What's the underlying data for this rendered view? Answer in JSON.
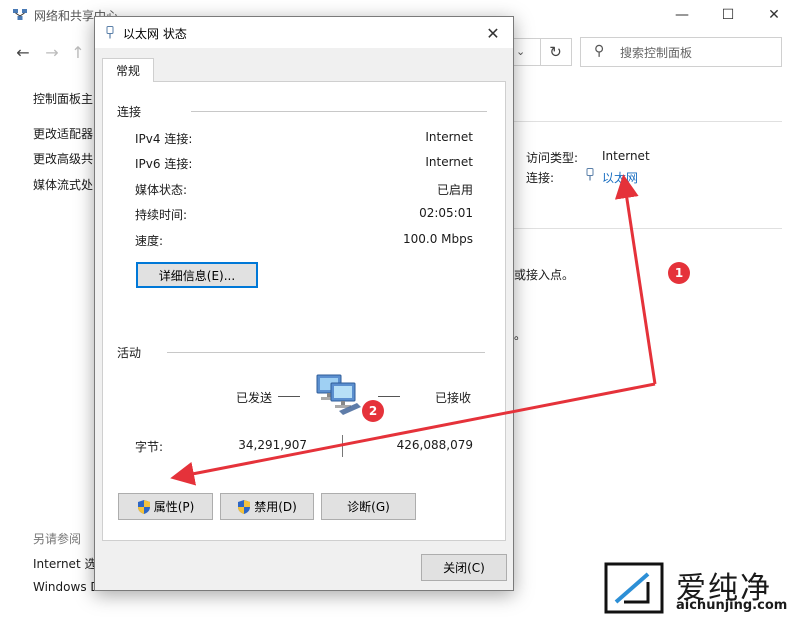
{
  "background_window": {
    "title": "网络和共享中心",
    "controls": {
      "minimize": "—",
      "maximize": "☐",
      "close": "✕"
    },
    "nav": {
      "back": "←",
      "forward": "→",
      "up": "↑",
      "refresh": "↻"
    },
    "search_placeholder": "搜索控制面板",
    "sidebar": {
      "home": "控制面板主",
      "links": [
        "更改适配器",
        "更改高级共",
        "媒体流式处"
      ],
      "see_also_label": "另请参阅",
      "see_also": [
        "Internet 选",
        "Windows D"
      ]
    },
    "access_type_label": "访问类型:",
    "access_type_value": "Internet",
    "connection_label": "连接:",
    "connection_value": "以太网",
    "fragment1": "或接入点。",
    "fragment2": "。"
  },
  "dialog": {
    "title": "以太网 状态",
    "close_glyph": "✕",
    "tab": "常规",
    "connection_group": "连接",
    "rows": [
      {
        "key": "IPv4 连接:",
        "value": "Internet"
      },
      {
        "key": "IPv6 连接:",
        "value": "Internet"
      },
      {
        "key": "媒体状态:",
        "value": "已启用"
      },
      {
        "key": "持续时间:",
        "value": "02:05:01"
      },
      {
        "key": "速度:",
        "value": "100.0 Mbps"
      }
    ],
    "details_button": "详细信息(E)...",
    "activity_group": "活动",
    "sent_label": "已发送",
    "received_label": "已接收",
    "bytes_label": "字节:",
    "bytes_sent": "34,291,907",
    "bytes_received": "426,088,079",
    "properties_button": "属性(P)",
    "disable_button": "禁用(D)",
    "diagnose_button": "诊断(G)",
    "close_button": "关闭(C)"
  },
  "annotations": {
    "badge1": "1",
    "badge2": "2",
    "arrow_color": "#e5323a"
  },
  "watermark": {
    "brand": "爱纯净",
    "url": "aichunjing.com"
  },
  "icons": [
    "network-share-icon",
    "ethernet-icon",
    "search-icon",
    "refresh-icon",
    "shield-icon",
    "computers-icon",
    "close-icon"
  ]
}
